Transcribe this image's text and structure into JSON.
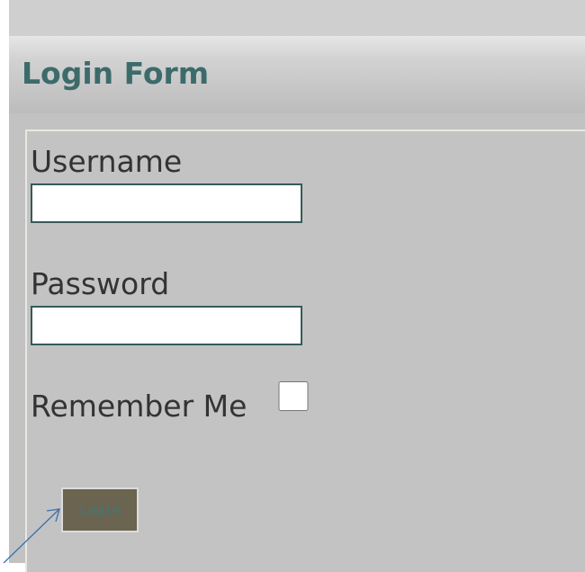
{
  "header": {
    "title": "Login Form"
  },
  "form": {
    "username_label": "Username",
    "username_value": "",
    "password_label": "Password",
    "password_value": "",
    "remember_label": "Remember Me",
    "remember_checked": false,
    "login_button_label": "Login"
  },
  "colors": {
    "title": "#3d6b6b",
    "field_border": "#375a5a",
    "button_background": "#6b6450",
    "annotation_arrow": "#3a6fb0"
  },
  "annotation": {
    "icon": "arrow-pointer-icon",
    "target": "login-button"
  }
}
